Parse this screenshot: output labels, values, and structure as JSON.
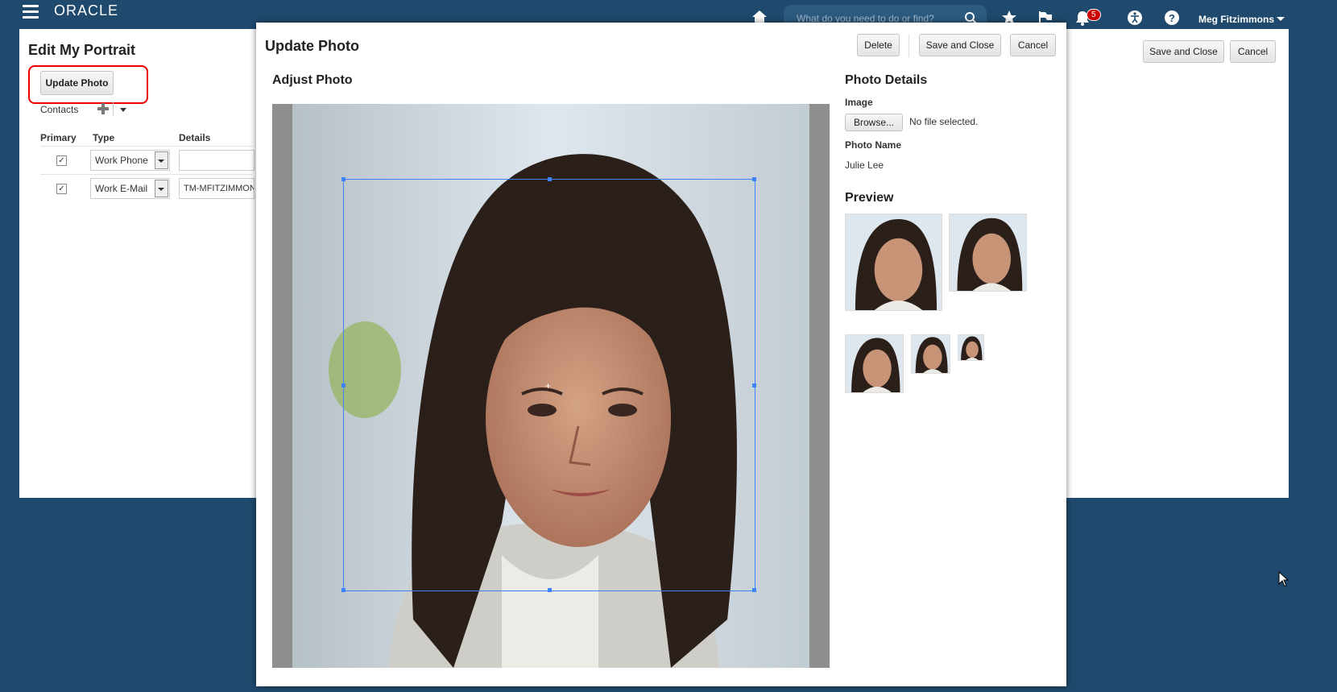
{
  "header": {
    "logo": "ORACLE",
    "search_placeholder": "What do you need to do or find?",
    "notification_count": "5",
    "user_name": "Meg Fitzimmons"
  },
  "background_page": {
    "title": "Edit My Portrait",
    "update_photo_label": "Update Photo",
    "save_close_label": "Save and Close",
    "cancel_label": "Cancel",
    "contacts_label": "Contacts",
    "columns": [
      "Primary",
      "Type",
      "Details"
    ],
    "rows": [
      {
        "primary": true,
        "type": "Work Phone",
        "details": ""
      },
      {
        "primary": true,
        "type": "Work E-Mail",
        "details": "TM-MFITZIMMON"
      }
    ]
  },
  "dialog": {
    "title": "Update Photo",
    "delete_label": "Delete",
    "save_close_label": "Save and Close",
    "cancel_label": "Cancel",
    "adjust_title": "Adjust Photo",
    "details_title": "Photo Details",
    "image_label": "Image",
    "browse_label": "Browse...",
    "no_file_text": "No file selected.",
    "photo_name_label": "Photo Name",
    "photo_name_value": "Julie Lee",
    "preview_title": "Preview"
  },
  "colors": {
    "header_bg": "#1f4a6e",
    "crop_border": "#3b83ff",
    "highlight": "#e00000",
    "badge": "#cc0000"
  }
}
